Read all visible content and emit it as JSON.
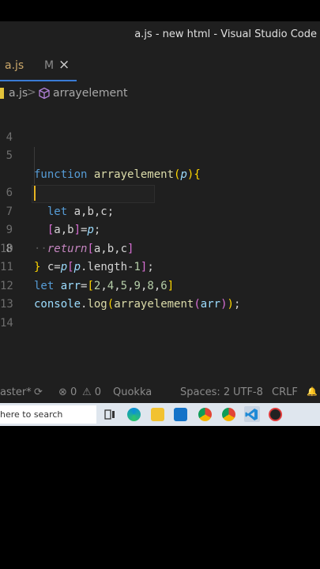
{
  "window": {
    "title": "a.js - new html - Visual Studio Code"
  },
  "tab": {
    "name": "a.js",
    "modified_marker": "M",
    "close_glyph": "×"
  },
  "breadcrumb": {
    "file": "a.js",
    "separator": ">",
    "symbol": "arrayelement"
  },
  "line_numbers": [
    "4",
    "5",
    "6",
    "7",
    "8",
    "9",
    "10",
    "11",
    "12",
    "13",
    "14"
  ],
  "code": {
    "l5": {
      "kw": "function",
      "name": "arrayelement",
      "open": "(",
      "param": "p",
      "close": "){"
    },
    "l6": {
      "kw": "let",
      "rest": " a,b,c;"
    },
    "l7": {
      "ob": "[",
      "vars": "a,b",
      "cb": "]",
      "eq": "=",
      "p": "p",
      "semi": ";"
    },
    "l8": {
      "c": "c=",
      "p": "p",
      "ob": "[",
      "p2": "p",
      "prop": ".length-",
      "num": "1",
      "cb": "]",
      "semi": ";"
    },
    "l9": {
      "dots": "··",
      "kw": "return",
      "ob": "[",
      "vars": "a,b,c",
      "cb": "]"
    },
    "l10": {
      "brace": "}"
    },
    "l11": {
      "kw": "let",
      "name": " arr",
      "eq": "=",
      "ob": "[",
      "n": [
        "2",
        "4",
        "5",
        "9",
        "8",
        "6"
      ],
      "cb": "]"
    },
    "l12": {
      "obj": "console",
      "dot": ".",
      "fn": "log",
      "o1": "(",
      "fn2": "arrayelement",
      "o2": "(",
      "arg": "arr",
      "c2": ")",
      "c1": ")",
      "semi": ";"
    }
  },
  "status": {
    "branch": "aster*",
    "sync_glyph": "⟳",
    "errors": "⊗ 0",
    "warnings": "⚠ 0",
    "quokka": "Quokka",
    "spaces": "Spaces: 2",
    "encoding": "UTF-8",
    "eol": "CRLF",
    "bell_glyph": "🔔"
  },
  "taskbar": {
    "search_placeholder": "here to search"
  },
  "colors": {
    "editor_bg": "#1f1f1f",
    "accent": "#3a7bd5",
    "cursor": "#e6b422"
  }
}
